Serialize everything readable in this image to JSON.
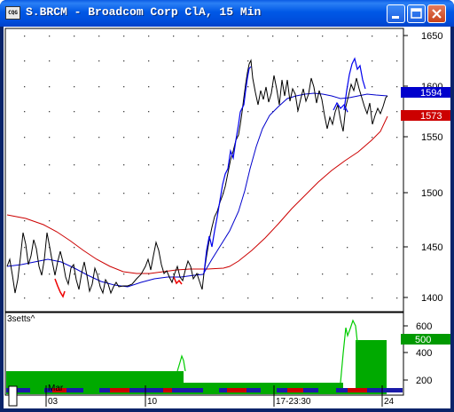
{
  "window": {
    "title": "S.BRCM - Broadcom Corp ClA, 15 Min",
    "app_icon_text": "CQG",
    "buttons": [
      "minimize",
      "maximize",
      "close"
    ]
  },
  "chart": {
    "price_ticks": [
      "1650",
      "1600",
      "1550",
      "1500",
      "1450",
      "1400"
    ],
    "last_price_badge": "1594",
    "ma_price_badge": "1573",
    "study_label": "3setts^",
    "study_ticks": [
      "600",
      "400",
      "200"
    ],
    "study_badge": "500",
    "time_labels": [
      "Mar",
      "03",
      "10",
      "17-23:30",
      "24"
    ],
    "colors": {
      "ma_slow": "#cc0000",
      "ma_fast": "#0000cc",
      "badge_blue": "#0000cc",
      "badge_red": "#cc0000",
      "badge_green": "#009900",
      "study_green": "#00aa00"
    }
  }
}
